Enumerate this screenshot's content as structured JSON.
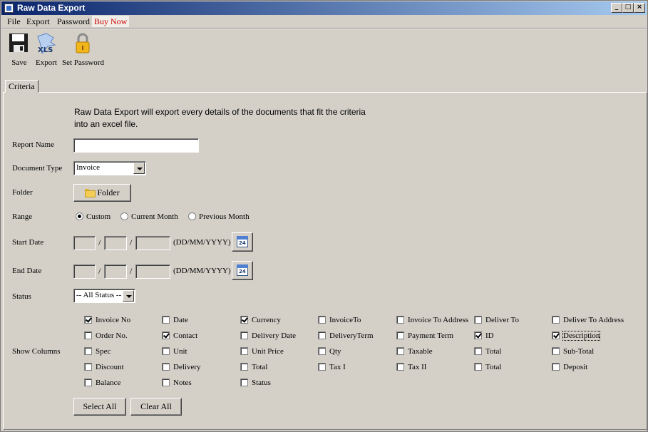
{
  "window": {
    "title": "Raw Data Export"
  },
  "window_controls": {
    "minimize": "_",
    "maximize": "□",
    "close": "×"
  },
  "menu": {
    "file": "File",
    "export": "Export",
    "password": "Password",
    "buy": "Buy Now"
  },
  "toolbar": {
    "save": "Save",
    "export": "Export",
    "set_password": "Set Password",
    "xls": "XLS"
  },
  "tabs": {
    "criteria": "Criteria"
  },
  "intro": {
    "line1": "Raw Data Export will export every details of the documents that fit the criteria",
    "line2": "into an excel file."
  },
  "form": {
    "report_name_label": "Report Name",
    "report_name_value": "",
    "document_type_label": "Document Type",
    "document_type_value": "Invoice",
    "folder_label": "Folder",
    "folder_button": "Folder",
    "range_label": "Range",
    "range_options": [
      "Custom",
      "Current Month",
      "Previous Month"
    ],
    "range_selected": "Custom",
    "start_date_label": "Start Date",
    "end_date_label": "End Date",
    "date_separator": "/",
    "date_format": "(DD/MM/YYYY)",
    "calendar_day": "24",
    "status_label": "Status",
    "status_value": "-- All Status --",
    "show_columns_label": "Show Columns"
  },
  "columns": [
    [
      {
        "label": "Invoice No",
        "checked": true
      },
      {
        "label": "Date",
        "checked": false
      },
      {
        "label": "Currency",
        "checked": true
      },
      {
        "label": "InvoiceTo",
        "checked": false
      },
      {
        "label": "Invoice To Address",
        "checked": false
      },
      {
        "label": "Deliver To",
        "checked": false
      },
      {
        "label": "Deliver To Address",
        "checked": false
      }
    ],
    [
      {
        "label": "Order No.",
        "checked": false
      },
      {
        "label": "Contact",
        "checked": true
      },
      {
        "label": "Delivery Date",
        "checked": false
      },
      {
        "label": "DeliveryTerm",
        "checked": false
      },
      {
        "label": "Payment Term",
        "checked": false
      },
      {
        "label": "ID",
        "checked": true
      },
      {
        "label": "Description",
        "checked": true
      }
    ],
    [
      {
        "label": "Spec",
        "checked": false
      },
      {
        "label": "Unit",
        "checked": false
      },
      {
        "label": "Unit Price",
        "checked": false
      },
      {
        "label": "Qty",
        "checked": false
      },
      {
        "label": "Taxable",
        "checked": false
      },
      {
        "label": "Total",
        "checked": false
      },
      {
        "label": "Sub-Total",
        "checked": false
      }
    ],
    [
      {
        "label": "Discount",
        "checked": false
      },
      {
        "label": "Delivery",
        "checked": false
      },
      {
        "label": "Total",
        "checked": false
      },
      {
        "label": "Tax I",
        "checked": false
      },
      {
        "label": "Tax II",
        "checked": false
      },
      {
        "label": "Total",
        "checked": false
      },
      {
        "label": "Deposit",
        "checked": false
      }
    ],
    [
      {
        "label": "Balance",
        "checked": false
      },
      {
        "label": "Notes",
        "checked": false
      },
      {
        "label": "Status",
        "checked": false
      }
    ]
  ],
  "buttons": {
    "select_all": "Select All",
    "clear_all": "Clear All"
  }
}
